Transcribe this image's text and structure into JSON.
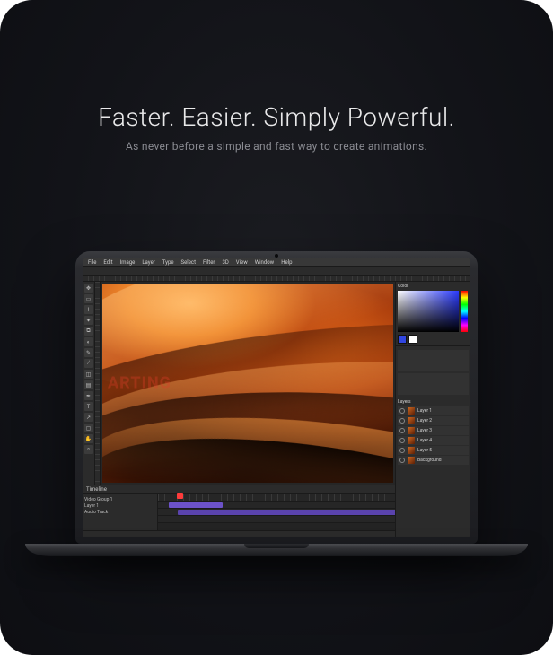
{
  "hero": {
    "headline": "Faster. Easier. Simply Powerful.",
    "subhead": "As never before a simple and fast way to create animations."
  },
  "app": {
    "menubar": [
      "File",
      "Edit",
      "Image",
      "Layer",
      "Type",
      "Select",
      "Filter",
      "3D",
      "View",
      "Window",
      "Help"
    ],
    "timeline": {
      "title": "Timeline",
      "tracks": [
        "Video Group 1",
        "  Layer 1",
        "Audio Track"
      ]
    },
    "panels": {
      "color_title": "Color",
      "layers_title": "Layers",
      "layers": [
        "Layer 1",
        "Layer 2",
        "Layer 3",
        "Layer 4",
        "Layer 5",
        "Background"
      ]
    },
    "watermark": "ARTING"
  }
}
